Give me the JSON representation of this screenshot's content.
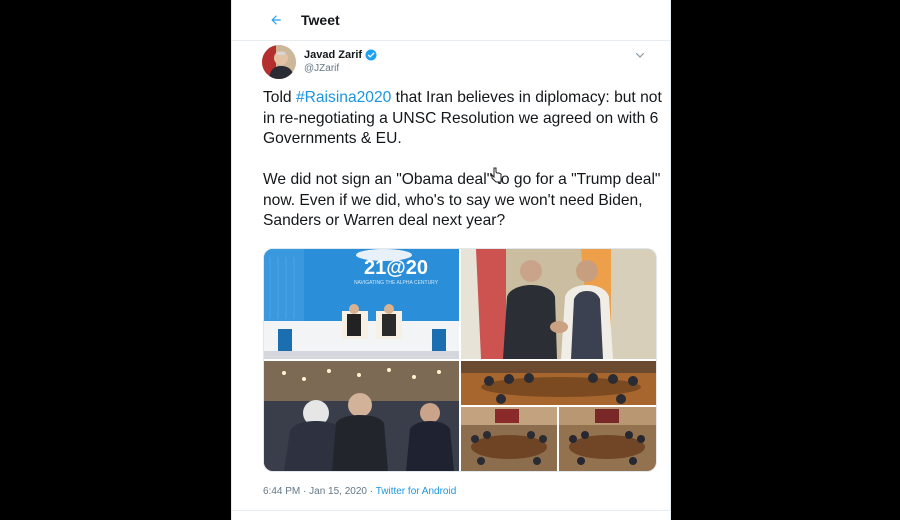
{
  "header": {
    "title": "Tweet",
    "back_icon": "arrow-left-icon"
  },
  "author": {
    "name": "Javad Zarif",
    "handle": "@JZarif",
    "verified": true
  },
  "tweet": {
    "para1_before": "Told ",
    "hashtag": "#Raisina2020",
    "para1_after": " that Iran believes in diplomacy: but not in re-negotiating a UNSC Resolution we agreed on with 6 Governments & EU.",
    "para2": "We did not sign an \"Obama deal\" to go for a \"Trump deal\" now. Even if we did, who's to say we won't need Biden, Sanders or Warren deal next year?"
  },
  "media": {
    "photo1_sign": "21@20",
    "photo1_subtitle": "NAVIGATING THE ALPHA CENTURY"
  },
  "meta": {
    "time": "6:44 PM",
    "sep1": " · ",
    "date": "Jan 15, 2020",
    "sep2": " · ",
    "source": "Twitter for Android"
  },
  "colors": {
    "accent": "#1da1f2",
    "link": "#1b95e0",
    "text": "#14171a",
    "muted": "#657786"
  }
}
